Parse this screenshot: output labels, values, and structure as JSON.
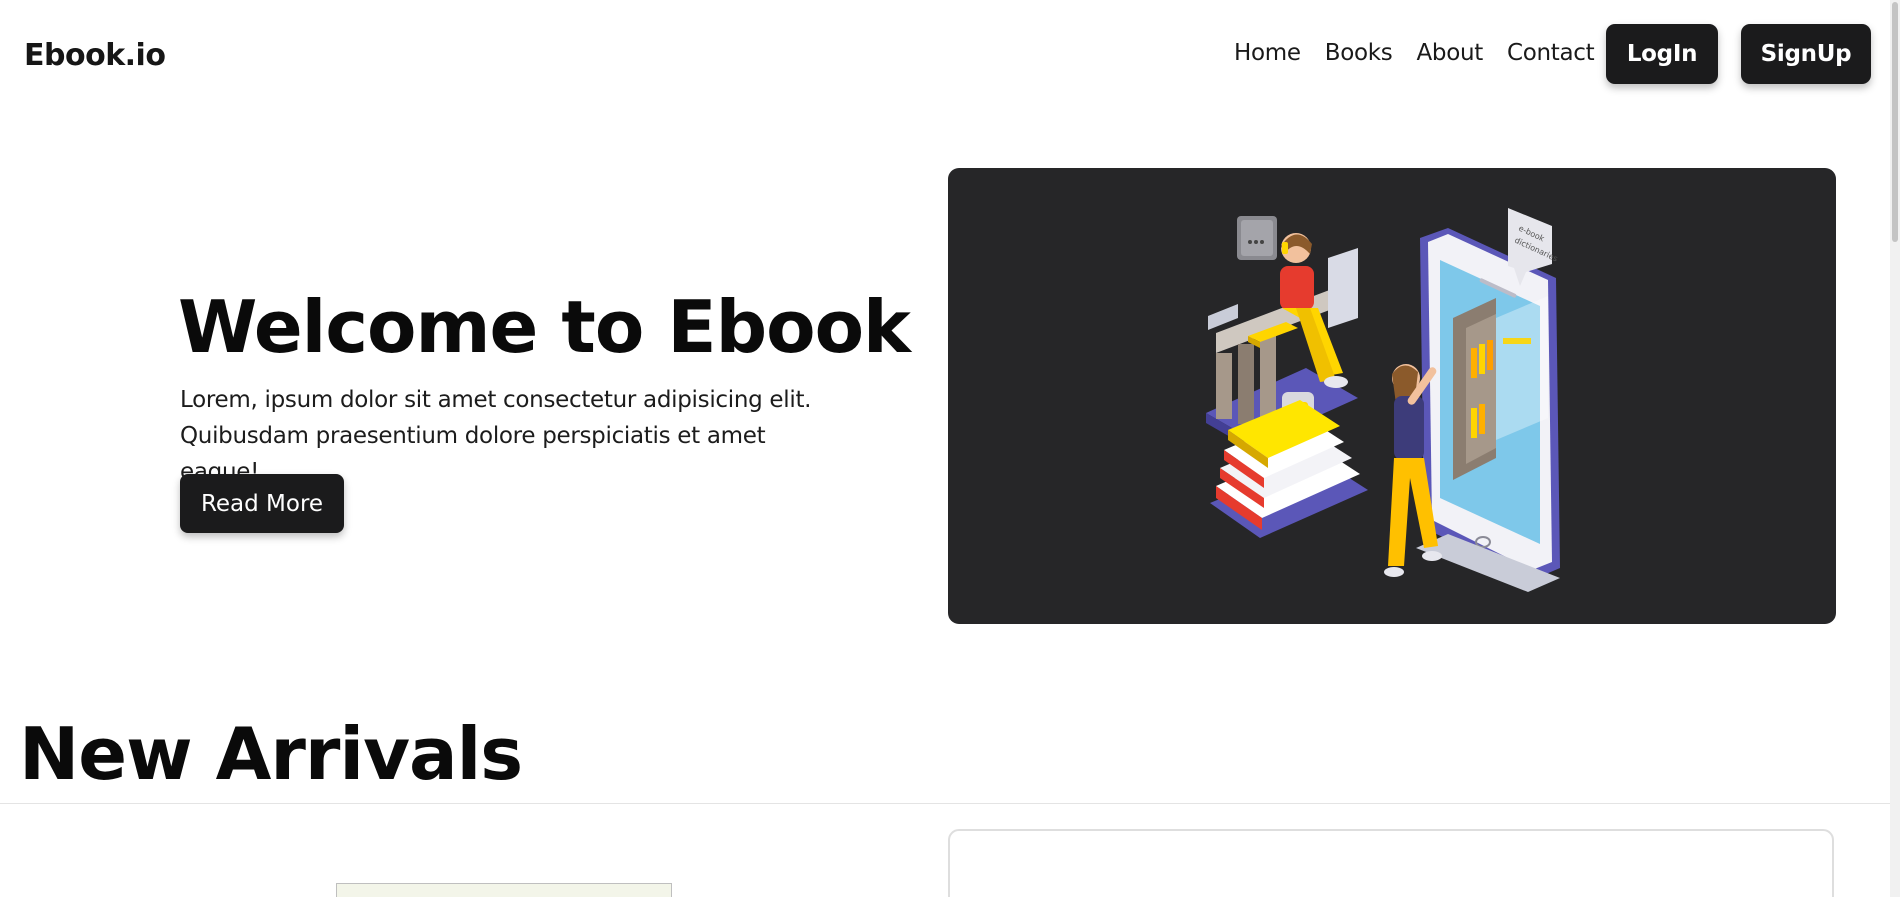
{
  "header": {
    "brand": "Ebook.io",
    "nav": [
      {
        "label": "Home"
      },
      {
        "label": "Books"
      },
      {
        "label": "About"
      },
      {
        "label": "Contact"
      }
    ],
    "login_label": "LogIn",
    "signup_label": "SignUp"
  },
  "hero": {
    "title": "Welcome to Ebook",
    "text": "Lorem, ipsum dolor sit amet consectetur adipisicing elit. Quibusdam praesentium dolore perspiciatis et amet eaque!",
    "button_label": "Read More",
    "illustration": {
      "bubble_text_1": "e-book",
      "bubble_text_2": "dictionaries"
    }
  },
  "arrivals": {
    "title": "New Arrivals"
  },
  "colors": {
    "dark": "#1b1b1c",
    "hero_bg": "#262628",
    "accent_purple": "#5b57b8",
    "accent_yellow": "#ffd500"
  }
}
